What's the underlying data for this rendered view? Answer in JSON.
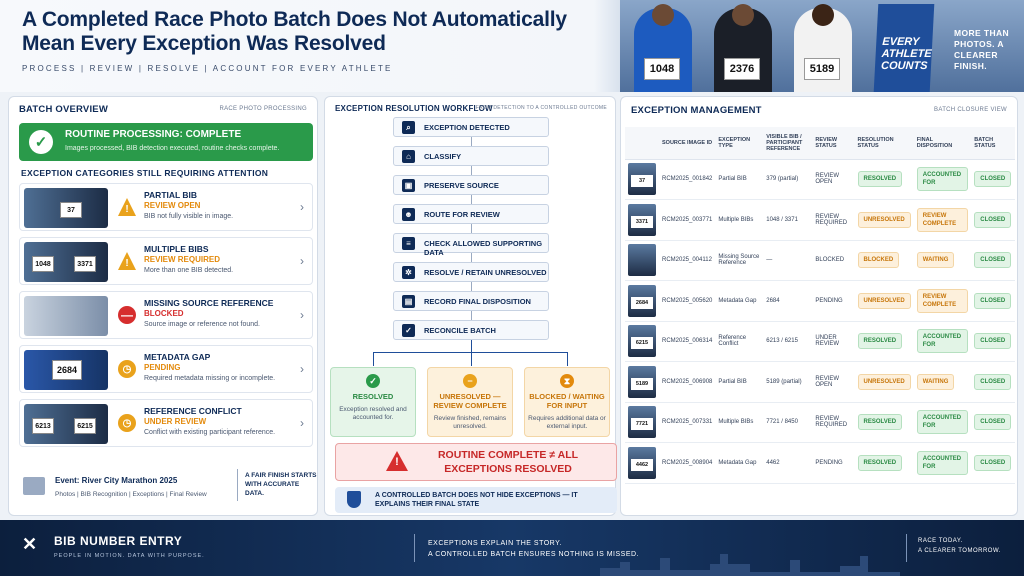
{
  "header": {
    "title": "A Completed Race Photo Batch Does Not Automatically Mean Every Exception Was Resolved",
    "subtitle": "PROCESS | REVIEW | RESOLVE | ACCOUNT FOR EVERY ATHLETE",
    "hero_bibs": [
      "1048",
      "2376",
      "5189"
    ],
    "sign_text": "EVERY ATHLETE COUNTS",
    "tagline": "MORE THAN PHOTOS. A CLEARER FINISH."
  },
  "batch": {
    "title": "BATCH OVERVIEW",
    "subtitle": "RACE PHOTO PROCESSING",
    "routine_title": "ROUTINE PROCESSING: COMPLETE",
    "routine_desc": "Images processed, BIB detection executed, routine checks complete.",
    "categories_heading": "EXCEPTION CATEGORIES STILL REQUIRING ATTENTION",
    "categories": [
      {
        "name": "PARTIAL BIB",
        "status": "REVIEW OPEN",
        "desc": "BIB not fully visible in image.",
        "icon": "warning-icon",
        "bibs": [
          "37"
        ]
      },
      {
        "name": "MULTIPLE BIBS",
        "status": "REVIEW REQUIRED",
        "desc": "More than one BIB detected.",
        "icon": "warning-icon",
        "bibs": [
          "1048",
          "3371"
        ]
      },
      {
        "name": "MISSING SOURCE REFERENCE",
        "status": "BLOCKED",
        "desc": "Source image or reference not found.",
        "icon": "blocked-icon",
        "bibs": []
      },
      {
        "name": "METADATA GAP",
        "status": "PENDING",
        "desc": "Required metadata missing or incomplete.",
        "icon": "clock-icon",
        "bibs": [
          "2684"
        ]
      },
      {
        "name": "REFERENCE CONFLICT",
        "status": "UNDER REVIEW",
        "desc": "Conflict with existing participant reference.",
        "icon": "clock-icon",
        "bibs": [
          "6213",
          "6215"
        ]
      }
    ],
    "event_name": "Event: River City Marathon 2025",
    "event_meta": "Photos  |  BIB Recognition  |  Exceptions  |  Final Review",
    "event_tagline": "A FAIR FINISH STARTS WITH ACCURATE DATA."
  },
  "workflow": {
    "title": "EXCEPTION RESOLUTION WORKFLOW",
    "subtitle": "FROM DETECTION TO A CONTROLLED OUTCOME",
    "steps": [
      "EXCEPTION DETECTED",
      "CLASSIFY",
      "PRESERVE SOURCE",
      "ROUTE FOR REVIEW",
      "CHECK ALLOWED SUPPORTING DATA",
      "RESOLVE / RETAIN UNRESOLVED",
      "RECORD FINAL DISPOSITION",
      "RECONCILE BATCH"
    ],
    "step_icons": [
      "search-doc-icon",
      "tag-icon",
      "image-icon",
      "people-icon",
      "database-icon",
      "gear-icon",
      "document-icon",
      "check-circle-icon"
    ],
    "outcomes": [
      {
        "title": "RESOLVED",
        "desc": "Exception resolved and accounted for.",
        "color": "#2a9a4a"
      },
      {
        "title": "UNRESOLVED — REVIEW COMPLETE",
        "desc": "Review finished, remains unresolved.",
        "color": "#e9a21c"
      },
      {
        "title": "BLOCKED / WAITING FOR INPUT",
        "desc": "Requires additional data or external input.",
        "color": "#e38a0c"
      }
    ],
    "warning": "ROUTINE COMPLETE ≠ ALL EXCEPTIONS RESOLVED",
    "control_note": "A CONTROLLED BATCH DOES NOT HIDE EXCEPTIONS — IT EXPLAINS THEIR FINAL STATE"
  },
  "exceptions": {
    "title": "EXCEPTION MANAGEMENT",
    "subtitle": "BATCH CLOSURE VIEW",
    "columns": [
      "SOURCE IMAGE ID",
      "EXCEPTION TYPE",
      "VISIBLE BIB / PARTICIPANT REFERENCE",
      "REVIEW STATUS",
      "RESOLUTION STATUS",
      "FINAL DISPOSITION",
      "BATCH STATUS"
    ],
    "rows": [
      {
        "thumb": "37",
        "id": "RCM2025_001842",
        "type": "Partial BIB",
        "ref": "379 (partial)",
        "review": "REVIEW OPEN",
        "resolution": "RESOLVED",
        "disposition": "ACCOUNTED FOR",
        "batch": "CLOSED"
      },
      {
        "thumb": "3371",
        "id": "RCM2025_003771",
        "type": "Multiple BIBs",
        "ref": "1048 / 3371",
        "review": "REVIEW REQUIRED",
        "resolution": "UNRESOLVED",
        "disposition": "REVIEW COMPLETE",
        "batch": "CLOSED"
      },
      {
        "thumb": "",
        "id": "RCM2025_004112",
        "type": "Missing Source Reference",
        "ref": "—",
        "review": "BLOCKED",
        "resolution": "BLOCKED",
        "disposition": "WAITING",
        "batch": "CLOSED"
      },
      {
        "thumb": "2684",
        "id": "RCM2025_005620",
        "type": "Metadata Gap",
        "ref": "2684",
        "review": "PENDING",
        "resolution": "UNRESOLVED",
        "disposition": "REVIEW COMPLETE",
        "batch": "CLOSED"
      },
      {
        "thumb": "6215",
        "id": "RCM2025_006314",
        "type": "Reference Conflict",
        "ref": "6213 / 6215",
        "review": "UNDER REVIEW",
        "resolution": "RESOLVED",
        "disposition": "ACCOUNTED FOR",
        "batch": "CLOSED"
      },
      {
        "thumb": "5189",
        "id": "RCM2025_006908",
        "type": "Partial BIB",
        "ref": "5189 (partial)",
        "review": "REVIEW OPEN",
        "resolution": "UNRESOLVED",
        "disposition": "WAITING",
        "batch": "CLOSED"
      },
      {
        "thumb": "7721",
        "id": "RCM2025_007331",
        "type": "Multiple BIBs",
        "ref": "7721 / 8450",
        "review": "REVIEW REQUIRED",
        "resolution": "RESOLVED",
        "disposition": "ACCOUNTED FOR",
        "batch": "CLOSED"
      },
      {
        "thumb": "4462",
        "id": "RCM2025_008904",
        "type": "Metadata Gap",
        "ref": "4462",
        "review": "PENDING",
        "resolution": "RESOLVED",
        "disposition": "ACCOUNTED FOR",
        "batch": "CLOSED"
      }
    ]
  },
  "footer": {
    "brand": "BIB NUMBER ENTRY",
    "brand_sub": "PEOPLE IN MOTION. DATA WITH PURPOSE.",
    "message_1": "EXCEPTIONS EXPLAIN THE STORY.",
    "message_2": "A CONTROLLED BATCH ENSURES NOTHING IS MISSED.",
    "end_1": "RACE TODAY.",
    "end_2": "A CLEARER TOMORROW."
  }
}
